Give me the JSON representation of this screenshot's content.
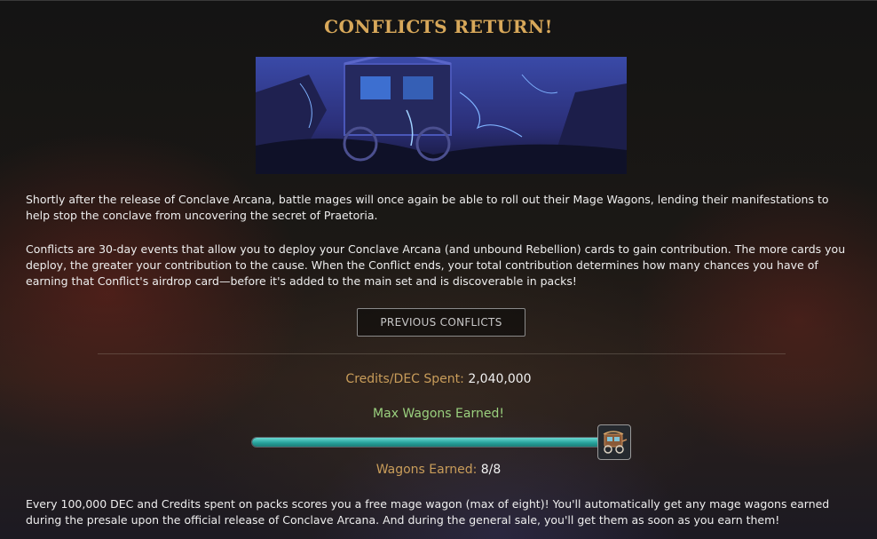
{
  "title": "CONFLICTS RETURN!",
  "paragraphs": {
    "intro": "Shortly after the release of Conclave Arcana, battle mages will once again be able to roll out their Mage Wagons, lending their manifestations to help stop the conclave from uncovering the secret of Praetoria.",
    "conflicts": "Conflicts are 30-day events that allow you to deploy your Conclave Arcana (and unbound Rebellion) cards to gain contribution. The more cards you deploy, the greater your contribution to the cause. When the Conflict ends, your total contribution determines how many chances you have of earning that Conflict's airdrop card—before it's added to the main set and is discoverable in packs!",
    "wagons": "Every 100,000 DEC and Credits spent on packs scores you a free mage wagon (max of eight)! You'll automatically get any mage wagons earned during the presale upon the official release of Conclave Arcana. And during the general sale, you'll get them as soon as you earn them!"
  },
  "previous_button": "PREVIOUS CONFLICTS",
  "stats": {
    "spent_label": "Credits/DEC Spent:",
    "spent_value": "2,040,000",
    "max_wagons": "Max Wagons Earned!",
    "earned_label": "Wagons Earned:",
    "earned_value": "8/8",
    "progress_fraction": 1.0
  },
  "icons": {
    "wagon": "mage-wagon-icon",
    "banner": "mage-wagon-banner-image"
  },
  "colors": {
    "title": "#d8a85a",
    "label_gold": "#c99d5a",
    "max_green": "#9ad07e",
    "bar_teal": "#28a39c"
  }
}
